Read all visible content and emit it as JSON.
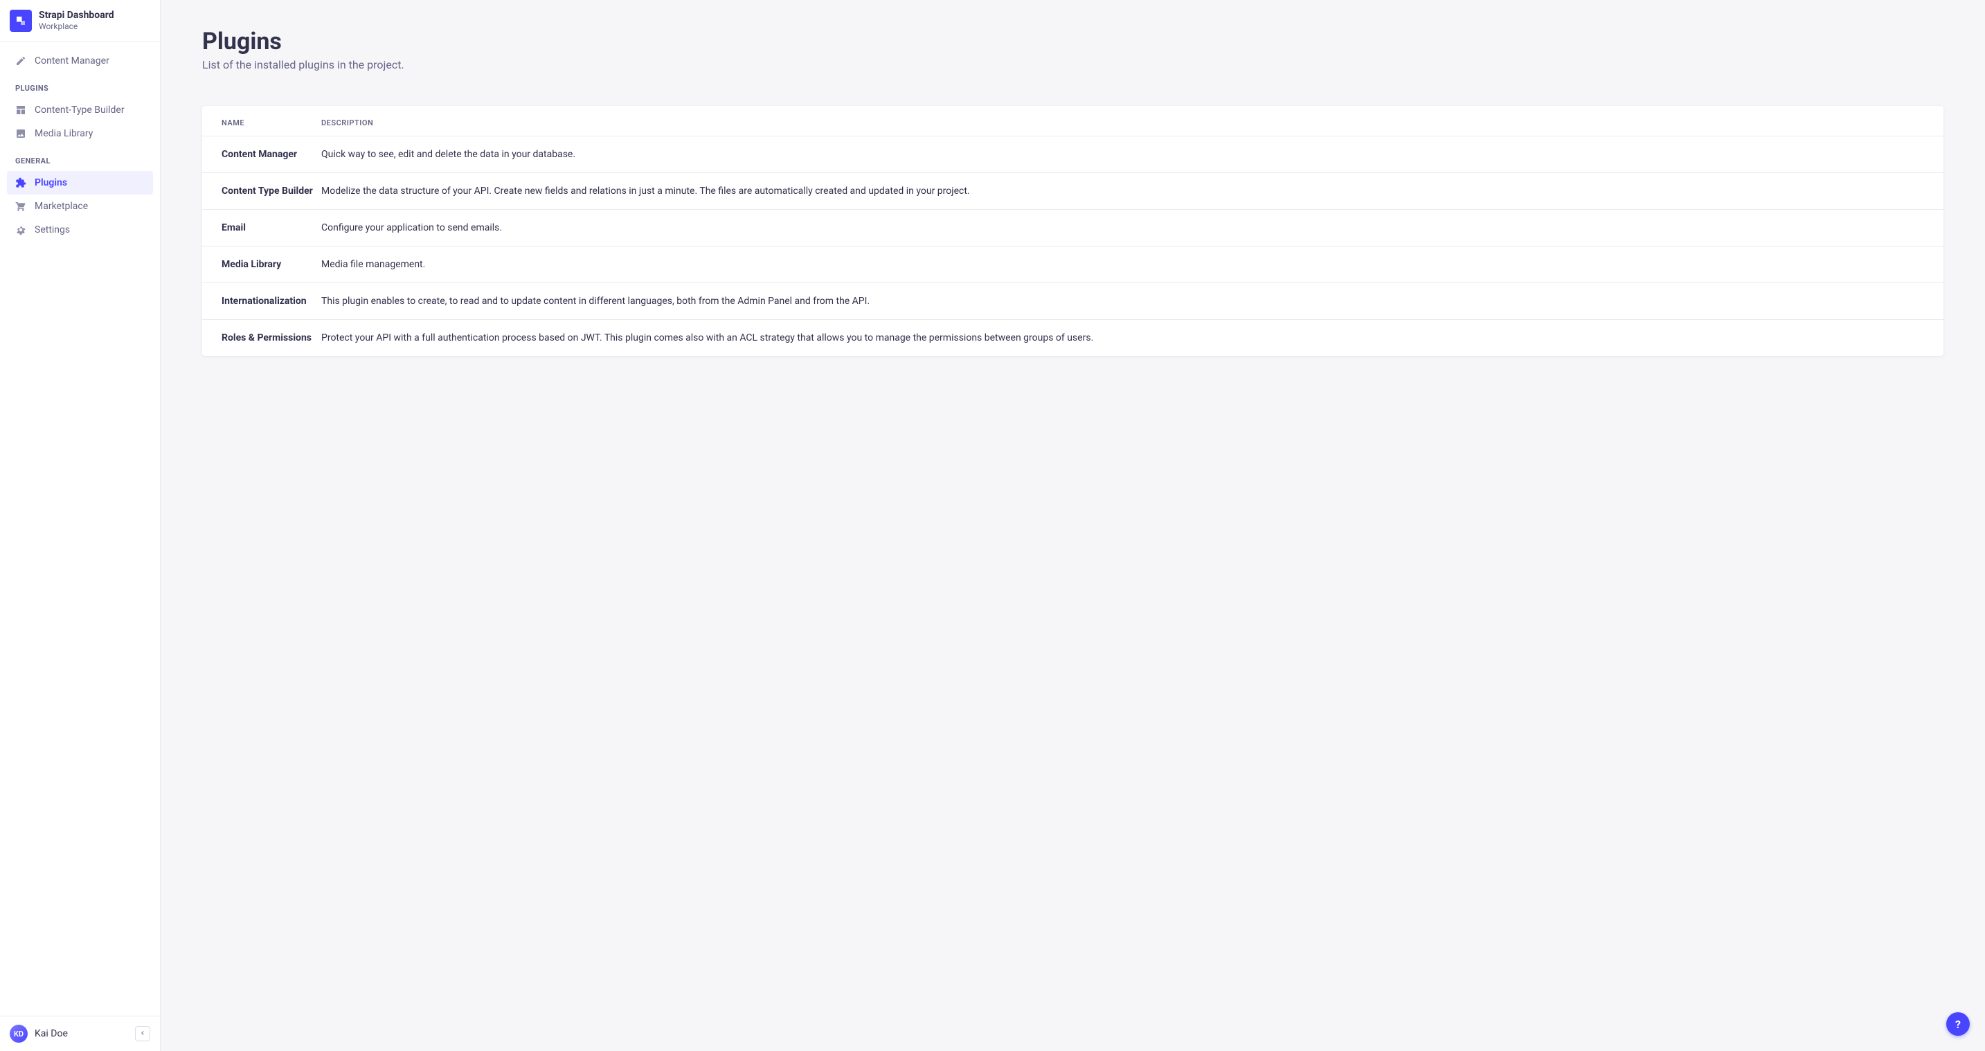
{
  "brand": {
    "title": "Strapi Dashboard",
    "subtitle": "Workplace"
  },
  "nav": {
    "top": [
      {
        "label": "Content Manager",
        "icon": "pencil-square-icon",
        "active": false
      }
    ],
    "sections": [
      {
        "title": "PLUGINS",
        "items": [
          {
            "label": "Content-Type Builder",
            "icon": "layout-icon",
            "active": false
          },
          {
            "label": "Media Library",
            "icon": "image-icon",
            "active": false
          }
        ]
      },
      {
        "title": "GENERAL",
        "items": [
          {
            "label": "Plugins",
            "icon": "puzzle-icon",
            "active": true
          },
          {
            "label": "Marketplace",
            "icon": "cart-icon",
            "active": false
          },
          {
            "label": "Settings",
            "icon": "gear-icon",
            "active": false
          }
        ]
      }
    ]
  },
  "user": {
    "initials": "KD",
    "name": "Kai Doe"
  },
  "page": {
    "title": "Plugins",
    "subtitle": "List of the installed plugins in the project."
  },
  "table": {
    "columns": [
      "NAME",
      "DESCRIPTION"
    ],
    "rows": [
      {
        "name": "Content Manager",
        "description": "Quick way to see, edit and delete the data in your database."
      },
      {
        "name": "Content Type Builder",
        "description": "Modelize the data structure of your API. Create new fields and relations in just a minute. The files are automatically created and updated in your project."
      },
      {
        "name": "Email",
        "description": "Configure your application to send emails."
      },
      {
        "name": "Media Library",
        "description": "Media file management."
      },
      {
        "name": "Internationalization",
        "description": "This plugin enables to create, to read and to update content in different languages, both from the Admin Panel and from the API."
      },
      {
        "name": "Roles & Permissions",
        "description": "Protect your API with a full authentication process based on JWT. This plugin comes also with an ACL strategy that allows you to manage the permissions between groups of users."
      }
    ]
  },
  "help": {
    "label": "?"
  }
}
